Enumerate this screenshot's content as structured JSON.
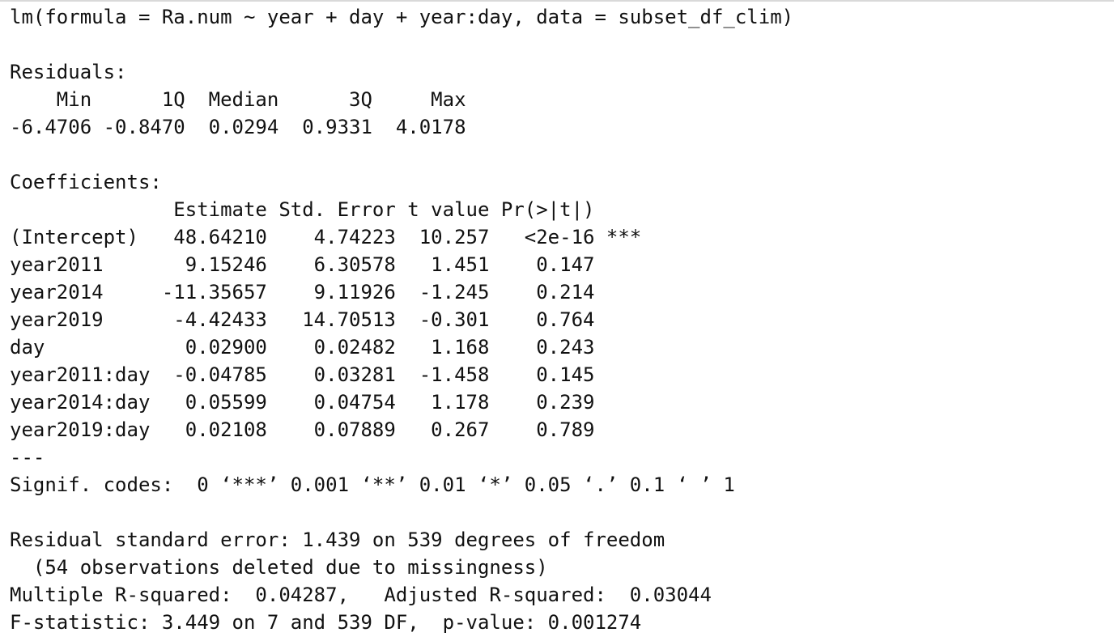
{
  "output": {
    "call": "lm(formula = Ra.num ~ year + day + year:day, data = subset_df_clim)",
    "residuals": {
      "label": "Residuals:",
      "header": "    Min      1Q  Median      3Q     Max ",
      "values": "-6.4706 -0.8470  0.0294  0.9331  4.0178 "
    },
    "coefficients": {
      "label": "Coefficients:",
      "header": "              Estimate Std. Error t value Pr(>|t|)    ",
      "rows": [
        "(Intercept)   48.64210    4.74223  10.257   <2e-16 ***",
        "year2011       9.15246    6.30578   1.451    0.147    ",
        "year2014     -11.35657    9.11926  -1.245    0.214    ",
        "year2019      -4.42433   14.70513  -0.301    0.764    ",
        "day            0.02900    0.02482   1.168    0.243    ",
        "year2011:day  -0.04785    0.03281  -1.458    0.145    ",
        "year2014:day   0.05599    0.04754   1.178    0.239    ",
        "year2019:day   0.02108    0.07889   0.267    0.789    "
      ],
      "separator": "---",
      "signif_codes": "Signif. codes:  0 ‘***’ 0.001 ‘**’ 0.01 ‘*’ 0.05 ‘.’ 0.1 ‘ ’ 1"
    },
    "summary": {
      "residual_se": "Residual standard error: 1.439 on 539 degrees of freedom",
      "missingness": "  (54 observations deleted due to missingness)",
      "r_squared": "Multiple R-squared:  0.04287,\tAdjusted R-squared:  0.03044 ",
      "f_statistic": "F-statistic: 3.449 on 7 and 539 DF,  p-value: 0.001274"
    }
  }
}
